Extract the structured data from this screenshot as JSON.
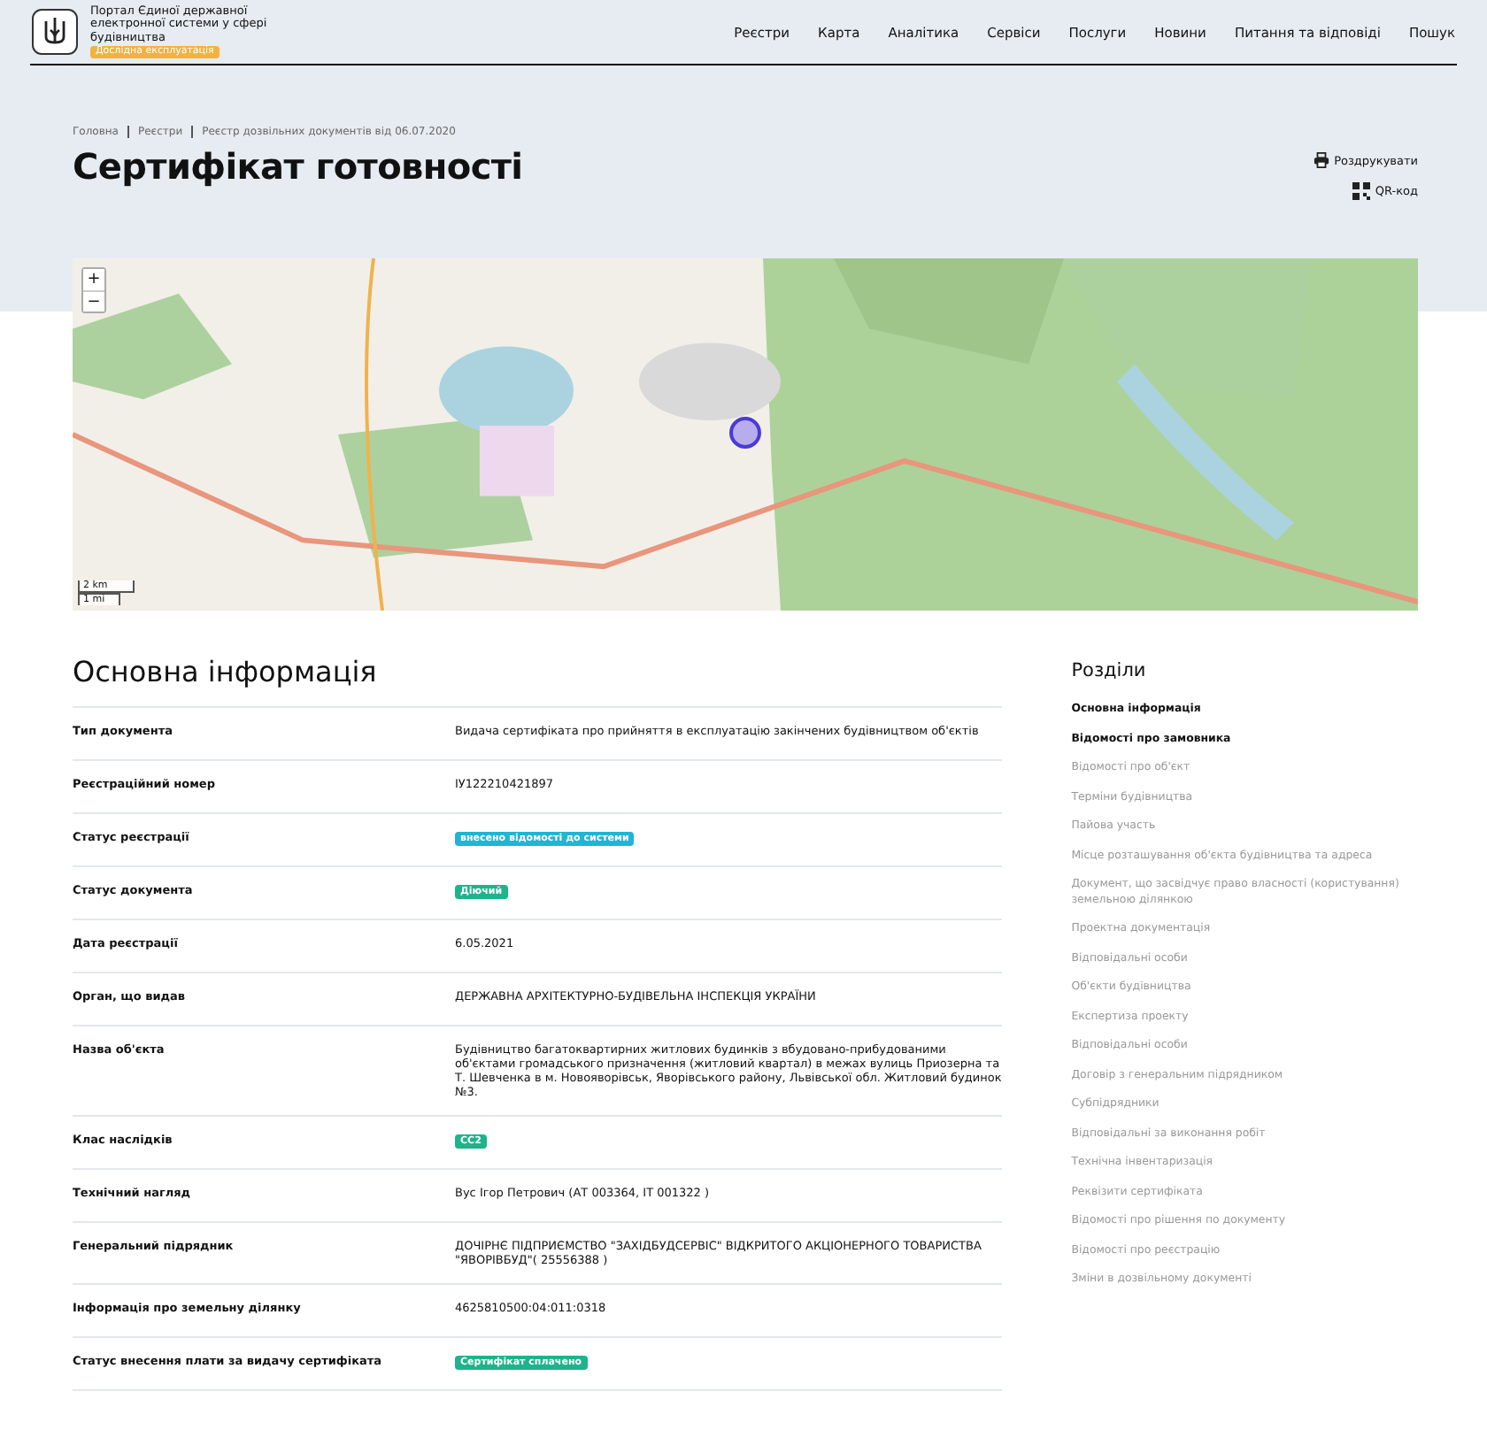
{
  "header": {
    "portal_title": "Портал Єдиної державної електронної системи у сфері будівництва",
    "badge": "Дослідна експлуатація",
    "nav": [
      {
        "label": "Реєстри"
      },
      {
        "label": "Карта"
      },
      {
        "label": "Аналітика"
      },
      {
        "label": "Сервіси"
      },
      {
        "label": "Послуги"
      },
      {
        "label": "Новини"
      },
      {
        "label": "Питання та відповіді"
      },
      {
        "label": "Пошук"
      }
    ]
  },
  "breadcrumbs": [
    "Головна",
    "Реєстри",
    "Реєстр дозвільних документів від 06.07.2020"
  ],
  "page_title": "Сертифікат готовності",
  "actions": [
    {
      "kind": "print",
      "label": "Роздрукувати"
    },
    {
      "kind": "qr",
      "label": "QR-код"
    }
  ],
  "map": {
    "zoom_in": "+",
    "zoom_out": "−",
    "scale": [
      "2 km",
      "1 mi"
    ]
  },
  "main": {
    "title": "Основна інформація",
    "rows": [
      {
        "label": "Тип документа",
        "kind": "text",
        "value": "Видача сертифіката про прийняття в експлуатацію закінчених будівництвом об'єктів"
      },
      {
        "label": "Реєстраційний номер",
        "kind": "text",
        "value": "ІУ122210421897"
      },
      {
        "label": "Статус реєстрації",
        "kind": "badge",
        "value": "внесено відомості до системи",
        "color": "#1fb5d6"
      },
      {
        "label": "Статус документа",
        "kind": "badge",
        "value": "Діючий",
        "color": "#1db38b"
      },
      {
        "label": "Дата реєстрації",
        "kind": "text",
        "value": "6.05.2021"
      },
      {
        "label": "Орган, що видав",
        "kind": "text",
        "value": "ДЕРЖАВНА АРХІТЕКТУРНО-БУДІВЕЛЬНА ІНСПЕКЦІЯ УКРАЇНИ"
      },
      {
        "label": "Назва об'єкта",
        "kind": "text",
        "value": "Будівництво багатоквартирних житлових будинків з вбудовано-прибудованими об'єктами громадського призначення (житловий квартал) в межах вулиць Приозерна та Т. Шевченка в м. Новояворівськ, Яворівського району, Львівської обл. Житловий будинок №3."
      },
      {
        "label": "Клас наслідків",
        "kind": "badge",
        "value": "СС2",
        "color": "#1db38b"
      },
      {
        "label": "Технічний нагляд",
        "kind": "text",
        "value": "Вус Ігор Петрович (АТ 003364, ІТ 001322 )"
      },
      {
        "label": "Генеральний підрядник",
        "kind": "text",
        "value": "ДОЧІРНЄ ПІДПРИЄМСТВО \"ЗАХІДБУДСЕРВІС\" ВІДКРИТОГО АКЦІОНЕРНОГО ТОВАРИСТВА \"ЯВОРІВБУД\"( 25556388 )"
      },
      {
        "label": "Інформація про земельну ділянку",
        "kind": "text",
        "value": "4625810500:04:011:0318"
      },
      {
        "label": "Статус внесення плати за видачу сертифіката",
        "kind": "badge",
        "value": "Сертифікат сплачено",
        "color": "#1db38b"
      }
    ]
  },
  "sections": {
    "title": "Розділи",
    "items": [
      {
        "label": "Основна інформація",
        "selected": true
      },
      {
        "label": "Відомості про замовника",
        "selected": true
      },
      {
        "label": "Відомості про об'єкт",
        "selected": false
      },
      {
        "label": "Терміни будівництва",
        "selected": false
      },
      {
        "label": "Пайова участь",
        "selected": false
      },
      {
        "label": "Місце розташування об'єкта будівництва та адреса",
        "selected": false
      },
      {
        "label": "Документ, що засвідчує право власності (користування) земельною ділянкою",
        "selected": false
      },
      {
        "label": "Проектна документація",
        "selected": false
      },
      {
        "label": "Відповідальні особи",
        "selected": false
      },
      {
        "label": "Об'єкти будівництва",
        "selected": false
      },
      {
        "label": "Експертиза проекту",
        "selected": false
      },
      {
        "label": "Відповідальні особи",
        "selected": false
      },
      {
        "label": "Договір з генеральним підрядником",
        "selected": false
      },
      {
        "label": "Субпідрядники",
        "selected": false
      },
      {
        "label": "Відповідальні за виконання робіт",
        "selected": false
      },
      {
        "label": "Технічна інвентаризація",
        "selected": false
      },
      {
        "label": "Реквізити сертифіката",
        "selected": false
      },
      {
        "label": "Відомості про рішення по документу",
        "selected": false
      },
      {
        "label": "Відомості про реєстрацію",
        "selected": false
      },
      {
        "label": "Зміни в дозвільному документі",
        "selected": false
      }
    ]
  }
}
